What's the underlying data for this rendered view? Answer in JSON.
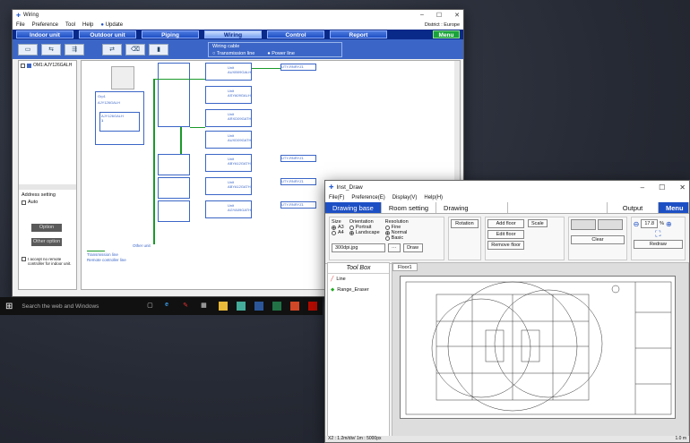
{
  "wiring": {
    "title": "Wiring",
    "menu": [
      "File",
      "Preference",
      "Tool",
      "Help",
      "Update"
    ],
    "district": "District : Europe",
    "modes": [
      "Indoor unit",
      "Outdoor unit",
      "Piping",
      "Wiring",
      "Control",
      "Report"
    ],
    "menu_button": "Menu",
    "cable_label": "Wiring cable",
    "cable_opt1": "Transmission line",
    "cable_opt2": "Power line",
    "tree_item": "OM1:AJY126GALH",
    "address_setting": "Address setting",
    "auto": "Auto",
    "option_btn1": "Option",
    "option_btn2": "Other option",
    "accept_remote": "I accept no remote controller for indoor unit.",
    "legend_transmission": "Transmission line",
    "legend_remote": "Remote controller line",
    "other_unit": "Other unit",
    "group_label": "Grp1",
    "group_model": "AJY126GALH",
    "group_box_model": "AJY126GALH",
    "group_box_num": "1",
    "units": [
      {
        "name": "Unit",
        "model": "AUXB09GALH"
      },
      {
        "name": "Unit",
        "model": "ASYA09GALH"
      },
      {
        "name": "Unit",
        "model": "ARXD09GATH"
      },
      {
        "name": "Unit",
        "model": "AUXD09GATH"
      },
      {
        "name": "Unit",
        "model": "ABYA12GATH"
      },
      {
        "name": "Unit",
        "model": "ABYA12GATH"
      },
      {
        "name": "Unit",
        "model": "AGYA09GATH"
      }
    ],
    "remote_label": "UTY-RNRYZ1"
  },
  "taskbar": {
    "search": "Search the web and Windows"
  },
  "instdraw": {
    "title": "Inst_Draw",
    "menu": [
      "File(F)",
      "Preference(E)",
      "Display(V)",
      "Help(H)"
    ],
    "tabs": [
      "Drawing base",
      "Room setting",
      "Drawing"
    ],
    "output_tab": "Output",
    "menu_tab": "Menu",
    "size_label": "Size",
    "size_a3": "A3",
    "size_a4": "A4",
    "orientation_label": "Orientation",
    "portrait": "Portrait",
    "landscape": "Landscape",
    "resolution_label": "Resolution",
    "res_fine": "Fine",
    "res_normal": "Normal",
    "res_basic": "Basic",
    "rotation": "Rotation",
    "add_floor": "Add floor",
    "edit_floor": "Edit floor",
    "remove_floor": "Remove floor",
    "scale": "Scale",
    "clear": "Clear",
    "zoom_value": "17.8",
    "zoom_unit": "%",
    "redraw": "Redraw",
    "file_name": "300dpi.jpg",
    "browse": "···",
    "draw": "Draw",
    "toolbox_header": "Tool Box",
    "tools": [
      "Line",
      "Range_Eraser"
    ],
    "floor_tab": "Floor1",
    "status_left": "X2 : 1.2m/div/ 1m : 5000px",
    "status_right": "1.0 m"
  }
}
